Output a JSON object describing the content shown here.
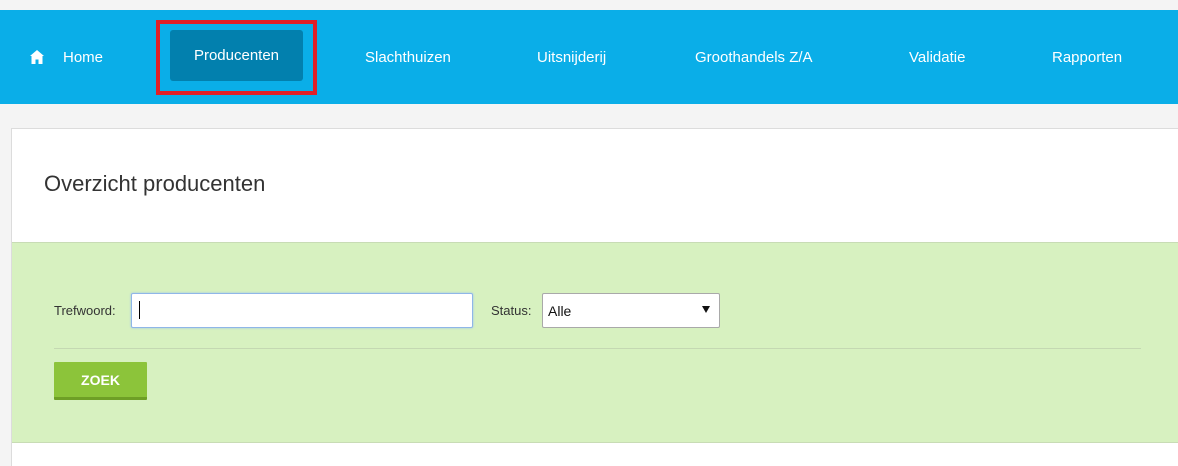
{
  "nav": {
    "home_label": "Home",
    "home_icon": "home-icon",
    "items": [
      {
        "label": "Producenten",
        "active": true
      },
      {
        "label": "Slachthuizen"
      },
      {
        "label": "Uitsnijderij"
      },
      {
        "label": "Groothandels Z/A"
      },
      {
        "label": "Validatie"
      },
      {
        "label": "Rapporten"
      }
    ],
    "bg_color": "#0aaee8",
    "active_color": "#0280ae",
    "highlight_color": "#e01f26"
  },
  "page": {
    "title": "Overzicht producenten"
  },
  "search": {
    "trefwoord_label": "Trefwoord:",
    "trefwoord_value": "",
    "status_label": "Status:",
    "status_selected": "Alle",
    "submit_label": "ZOEK",
    "panel_color": "#d7f1c0",
    "button_color": "#8cc43a"
  }
}
